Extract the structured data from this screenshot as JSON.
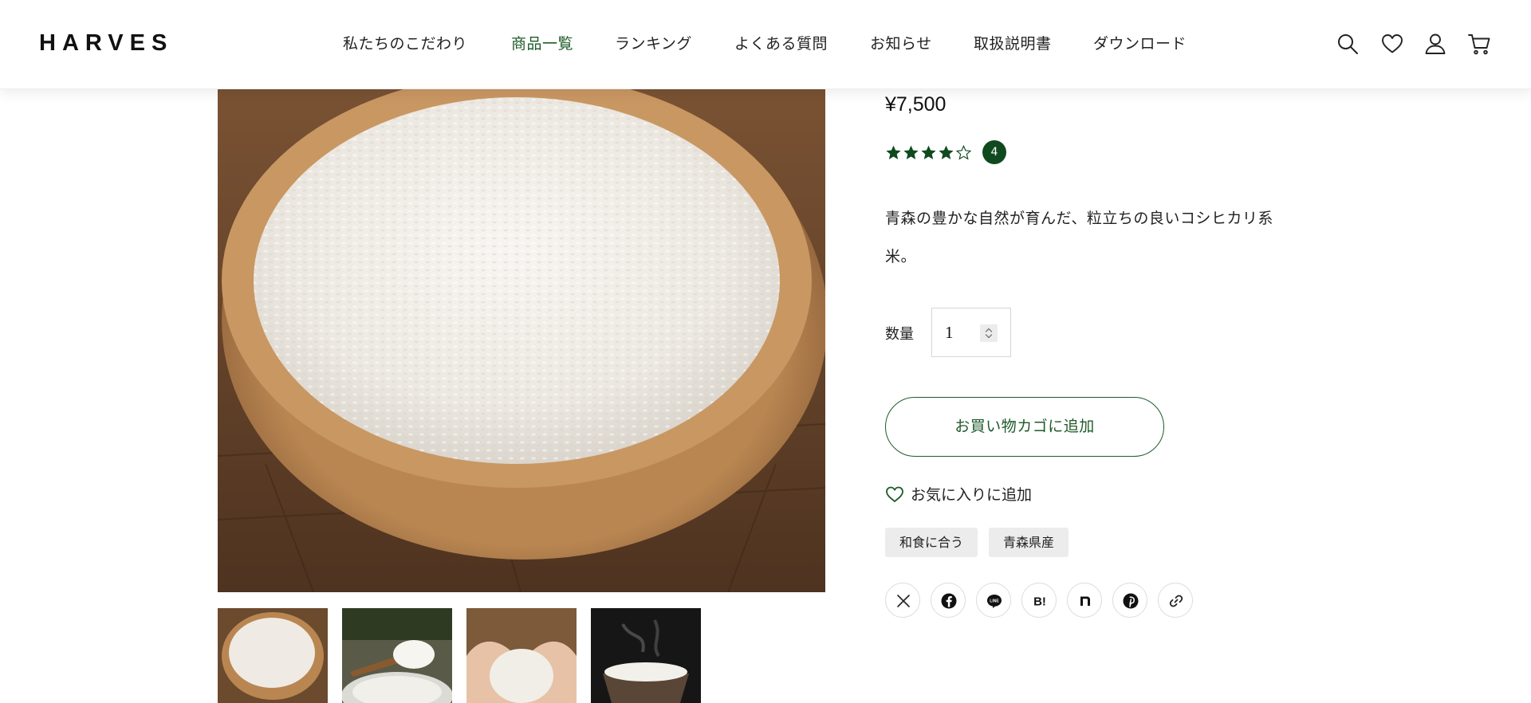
{
  "header": {
    "logo": "HARVES",
    "nav": [
      {
        "label": "私たちのこだわり",
        "active": false
      },
      {
        "label": "商品一覧",
        "active": true
      },
      {
        "label": "ランキング",
        "active": false
      },
      {
        "label": "よくある質問",
        "active": false
      },
      {
        "label": "お知らせ",
        "active": false
      },
      {
        "label": "取扱説明書",
        "active": false
      },
      {
        "label": "ダウンロード",
        "active": false
      }
    ],
    "icons": [
      "search-icon",
      "heart-icon",
      "user-icon",
      "cart-icon"
    ],
    "accent_color": "#1e5a2a"
  },
  "gallery": {
    "thumbnails": [
      "raw-rice-bowl",
      "rice-spoon",
      "rice-in-hands",
      "steamed-rice-bowl"
    ]
  },
  "product": {
    "price": "¥7,500",
    "rating": 4,
    "rating_max": 5,
    "review_count": "4",
    "description": "青森の豊かな自然が育んだ、粒立ちの良いコシヒカリ系米。",
    "quantity_label": "数量",
    "quantity_value": "1",
    "add_to_cart_label": "お買い物カゴに追加",
    "add_to_favorites_label": "お気に入りに追加",
    "tags": [
      "和食に合う",
      "青森県産"
    ],
    "share_icons": [
      "x-icon",
      "facebook-icon",
      "line-icon",
      "hatena-bookmark-icon",
      "note-icon",
      "pinterest-icon",
      "copy-link-icon"
    ],
    "badge_color": "#0f4a1e"
  }
}
